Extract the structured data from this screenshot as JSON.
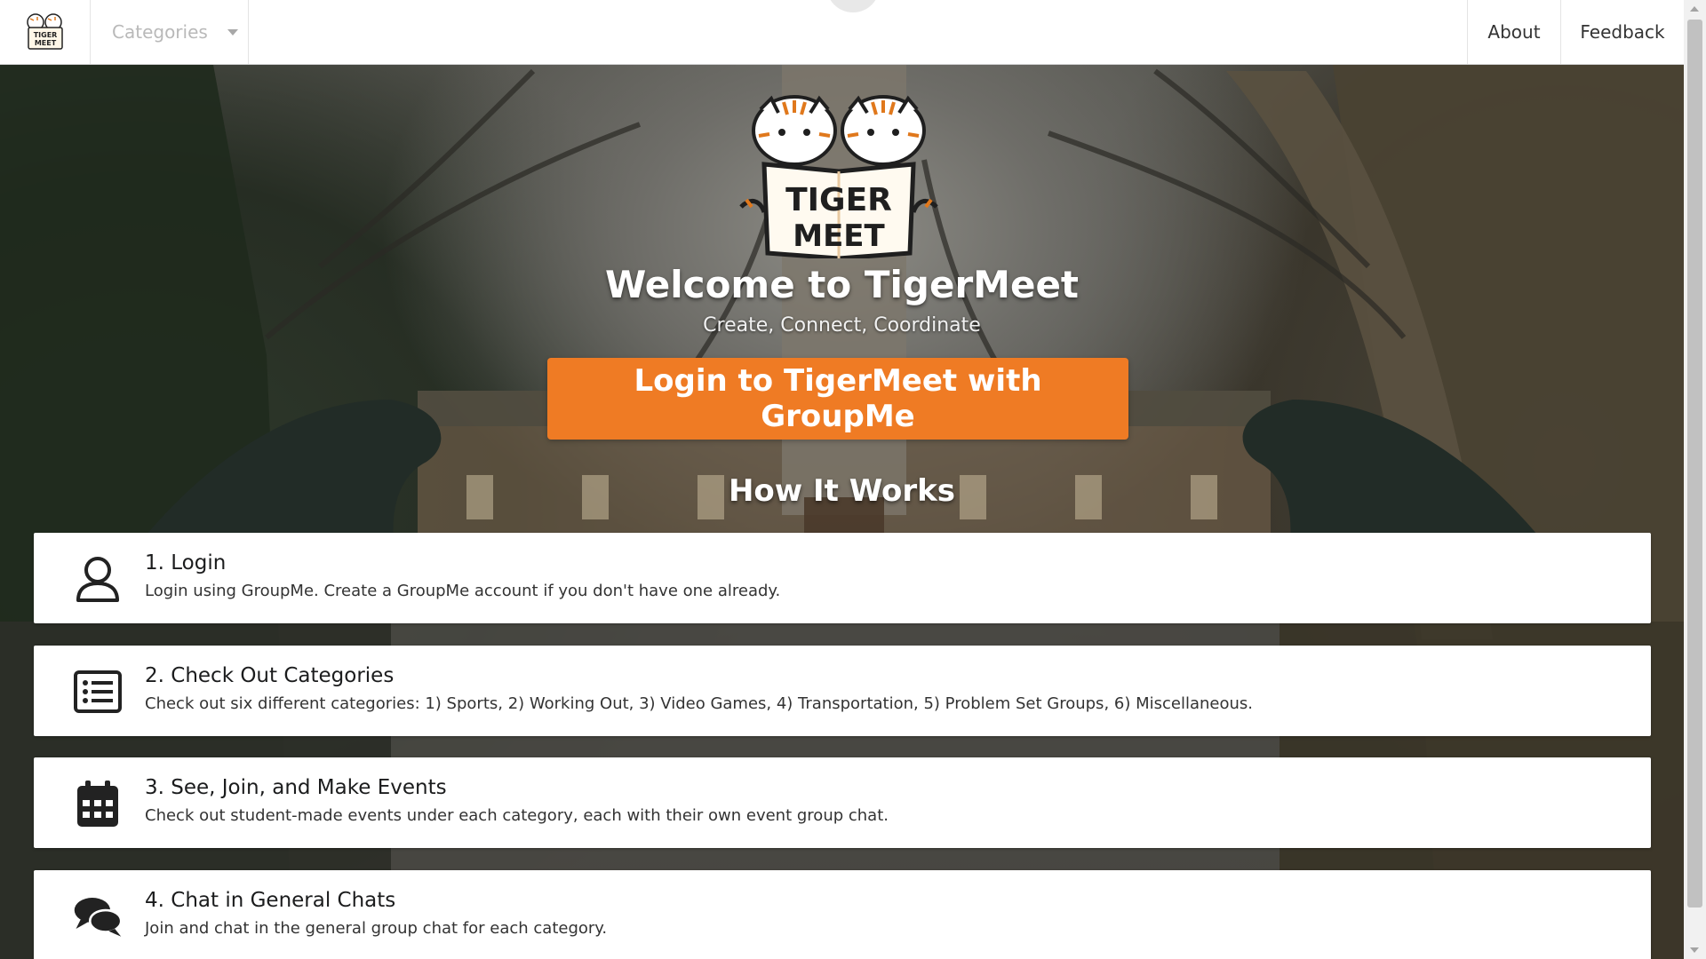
{
  "navbar": {
    "logo_alt": "TigerMeet",
    "categories_label": "Categories",
    "about_label": "About",
    "feedback_label": "Feedback"
  },
  "hero": {
    "logo_text_top": "TIGER",
    "logo_text_bottom": "MEET",
    "title": "Welcome to TigerMeet",
    "subtitle": "Create, Connect, Coordinate",
    "login_button": "Login to TigerMeet with GroupMe",
    "how_title": "How It Works"
  },
  "steps": [
    {
      "title": "1. Login",
      "description": "Login using GroupMe. Create a GroupMe account if you don't have one already.",
      "icon": "user-icon"
    },
    {
      "title": "2. Check Out Categories",
      "description": "Check out six different categories: 1) Sports, 2) Working Out, 3) Video Games, 4) Transportation, 5) Problem Set Groups, 6) Miscellaneous.",
      "icon": "list-icon"
    },
    {
      "title": "3. See, Join, and Make Events",
      "description": "Check out student-made events under each category, each with their own event group chat.",
      "icon": "calendar-icon"
    },
    {
      "title": "4. Chat in General Chats",
      "description": "Join and chat in the general group chat for each category.",
      "icon": "chat-icon"
    }
  ],
  "colors": {
    "accent": "#ef7b24",
    "navbar_bg": "#ffffff",
    "card_bg": "#ffffff"
  }
}
